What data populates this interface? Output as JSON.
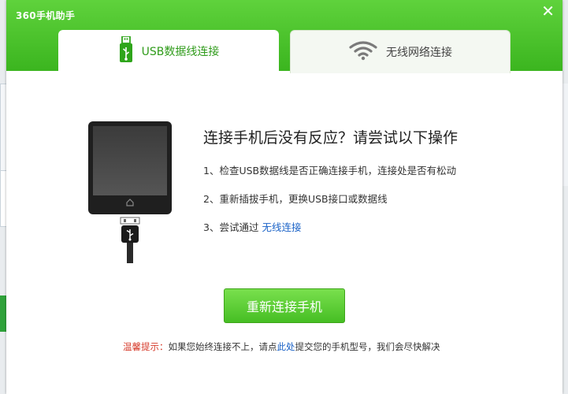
{
  "app": {
    "title": "360手机助手",
    "close_glyph": "✕"
  },
  "tabs": [
    {
      "label": "USB数据线连接",
      "icon": "usb-icon",
      "selected": true
    },
    {
      "label": "无线网络连接",
      "icon": "wifi-icon",
      "selected": false
    }
  ],
  "help": {
    "title": "连接手机后没有反应？请尝试以下操作",
    "steps": {
      "one": "1、检查USB数据线是否正确连接手机，连接处是否有松动",
      "two": "2、重新插拔手机，更换USB接口或数据线",
      "three_prefix": "3、尝试通过",
      "three_link": "无线连接"
    }
  },
  "reconnect_button": "重新连接手机",
  "tip": {
    "label": "温馨提示：",
    "text_before": "如果您始终连接不上，请点",
    "link": "此处",
    "text_after": "提交您的手机型号，我们会尽快解决"
  },
  "colors": {
    "brand_green": "#3bb51f",
    "link_blue": "#1a62c7",
    "tip_red": "#d63b2b"
  }
}
